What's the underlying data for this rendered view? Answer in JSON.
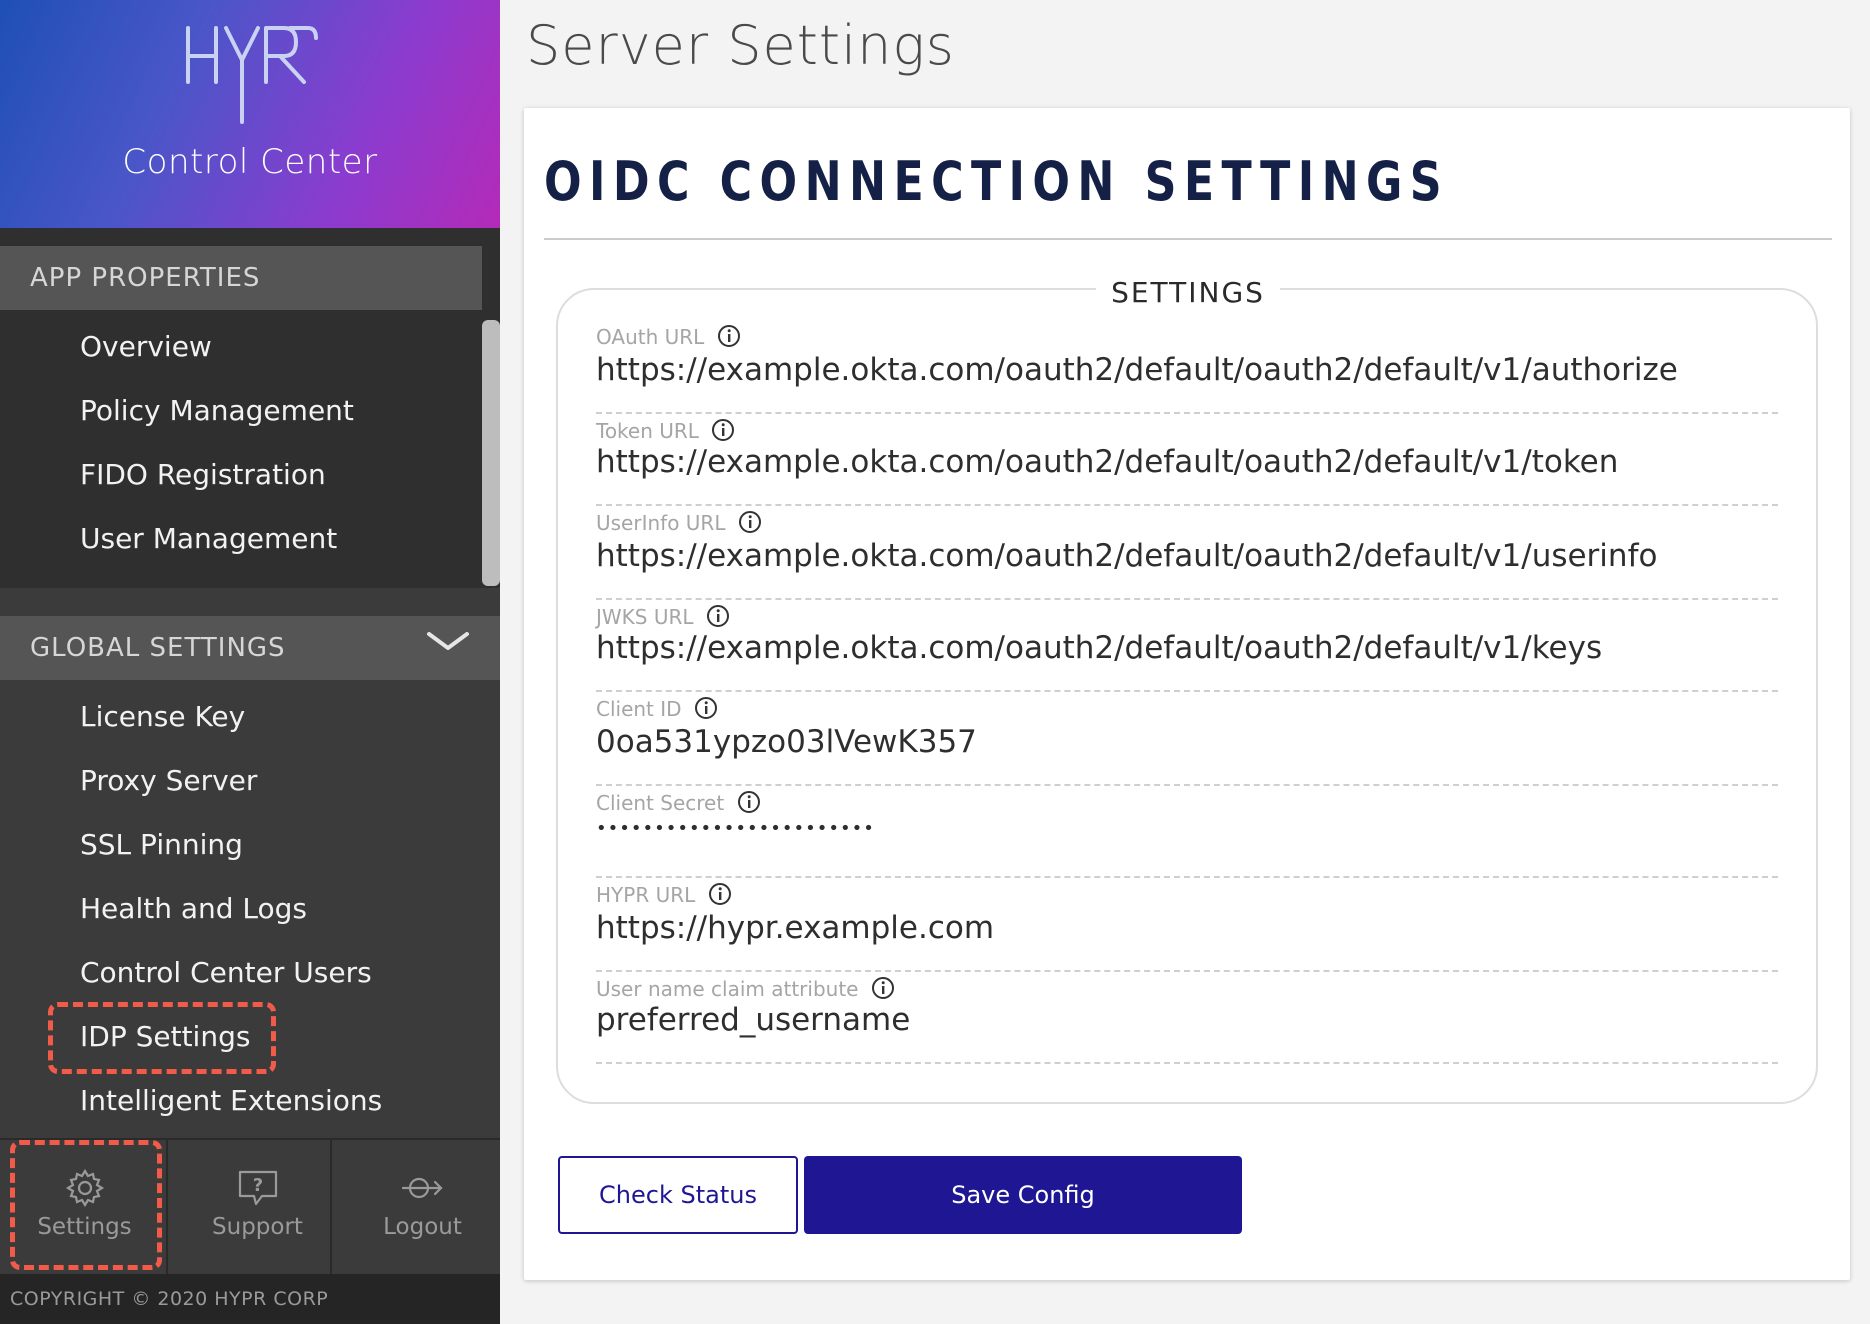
{
  "brand": {
    "logo_text": "HYPR",
    "product": "Control Center"
  },
  "sidebar": {
    "app_properties": {
      "header": "APP PROPERTIES",
      "items": [
        "Overview",
        "Policy Management",
        "FIDO Registration",
        "User Management"
      ]
    },
    "global_settings": {
      "header": "GLOBAL SETTINGS",
      "items": [
        "License Key",
        "Proxy Server",
        "SSL Pinning",
        "Health and Logs",
        "Control Center Users",
        "IDP Settings",
        "Intelligent Extensions"
      ],
      "highlighted": "IDP Settings"
    },
    "footer": [
      {
        "label": "Settings",
        "icon": "gear-icon",
        "highlighted": true
      },
      {
        "label": "Support",
        "icon": "question-bubble-icon"
      },
      {
        "label": "Logout",
        "icon": "logout-icon"
      }
    ],
    "copyright": "COPYRIGHT © 2020 HYPR CORP"
  },
  "page": {
    "title": "Server Settings",
    "card_title": "OIDC CONNECTION SETTINGS",
    "legend": "SETTINGS",
    "fields": [
      {
        "label": "OAuth URL",
        "value": "https://example.okta.com/oauth2/default/oauth2/default/v1/authorize"
      },
      {
        "label": "Token URL",
        "value": "https://example.okta.com/oauth2/default/oauth2/default/v1/token"
      },
      {
        "label": "UserInfo URL",
        "value": "https://example.okta.com/oauth2/default/oauth2/default/v1/userinfo"
      },
      {
        "label": "JWKS URL",
        "value": "https://example.okta.com/oauth2/default/oauth2/default/v1/keys"
      },
      {
        "label": "Client ID",
        "value": "0oa531ypzo03lVewK357"
      },
      {
        "label": "Client Secret",
        "value": "••••••••••••••••••••••••"
      },
      {
        "label": "HYPR URL",
        "value": "https://hypr.example.com"
      },
      {
        "label": "User name claim attribute",
        "value": "preferred_username"
      }
    ],
    "buttons": {
      "check_status": "Check Status",
      "save_config": "Save Config"
    }
  },
  "colors": {
    "accent": "#1f1694",
    "highlight": "#f25a4a",
    "title": "#142046"
  }
}
